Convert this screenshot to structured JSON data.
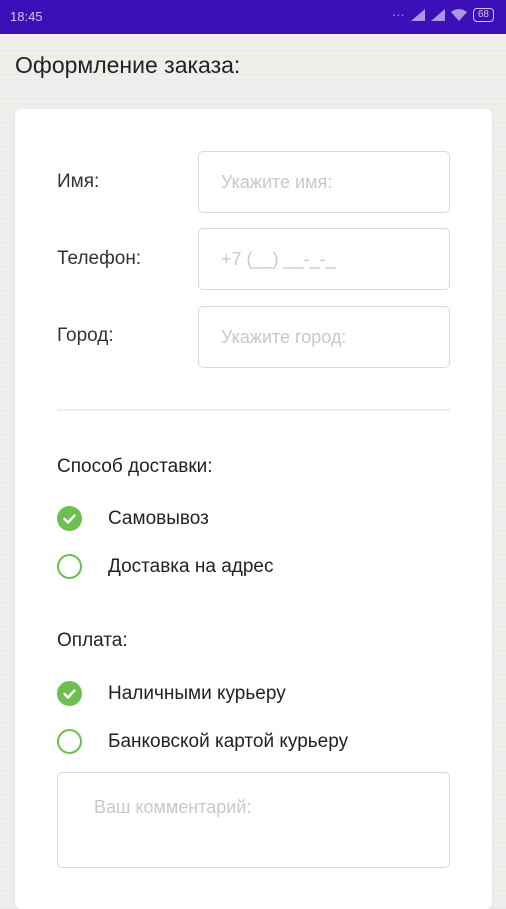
{
  "status_bar": {
    "time": "18:45",
    "battery": "68"
  },
  "page_title": "Оформление заказа:",
  "form": {
    "name": {
      "label": "Имя:",
      "placeholder": "Укажите имя:"
    },
    "phone": {
      "label": "Телефон:",
      "placeholder": "+7 (__) __-_-_"
    },
    "city": {
      "label": "Город:",
      "placeholder": "Укажите город:"
    }
  },
  "delivery": {
    "title": "Способ доставки:",
    "options": [
      {
        "label": "Самовывоз",
        "checked": true
      },
      {
        "label": "Доставка на адрес",
        "checked": false
      }
    ]
  },
  "payment": {
    "title": "Оплата:",
    "options": [
      {
        "label": "Наличными курьеру",
        "checked": true
      },
      {
        "label": "Банковской картой курьеру",
        "checked": false
      }
    ]
  },
  "comment": {
    "placeholder": "Ваш комментарий:"
  },
  "colors": {
    "accent": "#6dbf52",
    "status_bar": "#3d0fb8"
  }
}
